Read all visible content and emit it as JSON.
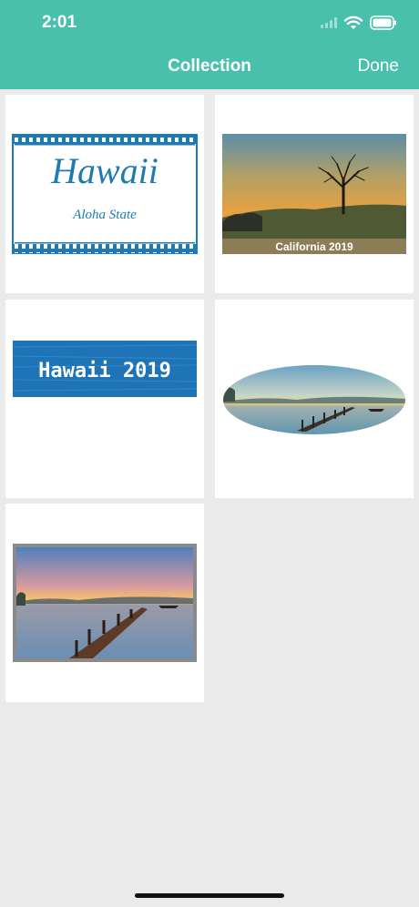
{
  "status_bar": {
    "time": "2:01"
  },
  "nav": {
    "title": "Collection",
    "done_label": "Done"
  },
  "items": [
    {
      "type": "film-label",
      "title": "Hawaii",
      "subtitle": "Aloha State"
    },
    {
      "type": "photo-caption",
      "caption": "California 2019"
    },
    {
      "type": "banner",
      "text": "Hawaii 2019"
    },
    {
      "type": "oval-photo"
    },
    {
      "type": "framed-photo"
    }
  ],
  "colors": {
    "header": "#49c0ac",
    "background": "#eaeaea",
    "accent_blue": "#1f7ab3"
  }
}
